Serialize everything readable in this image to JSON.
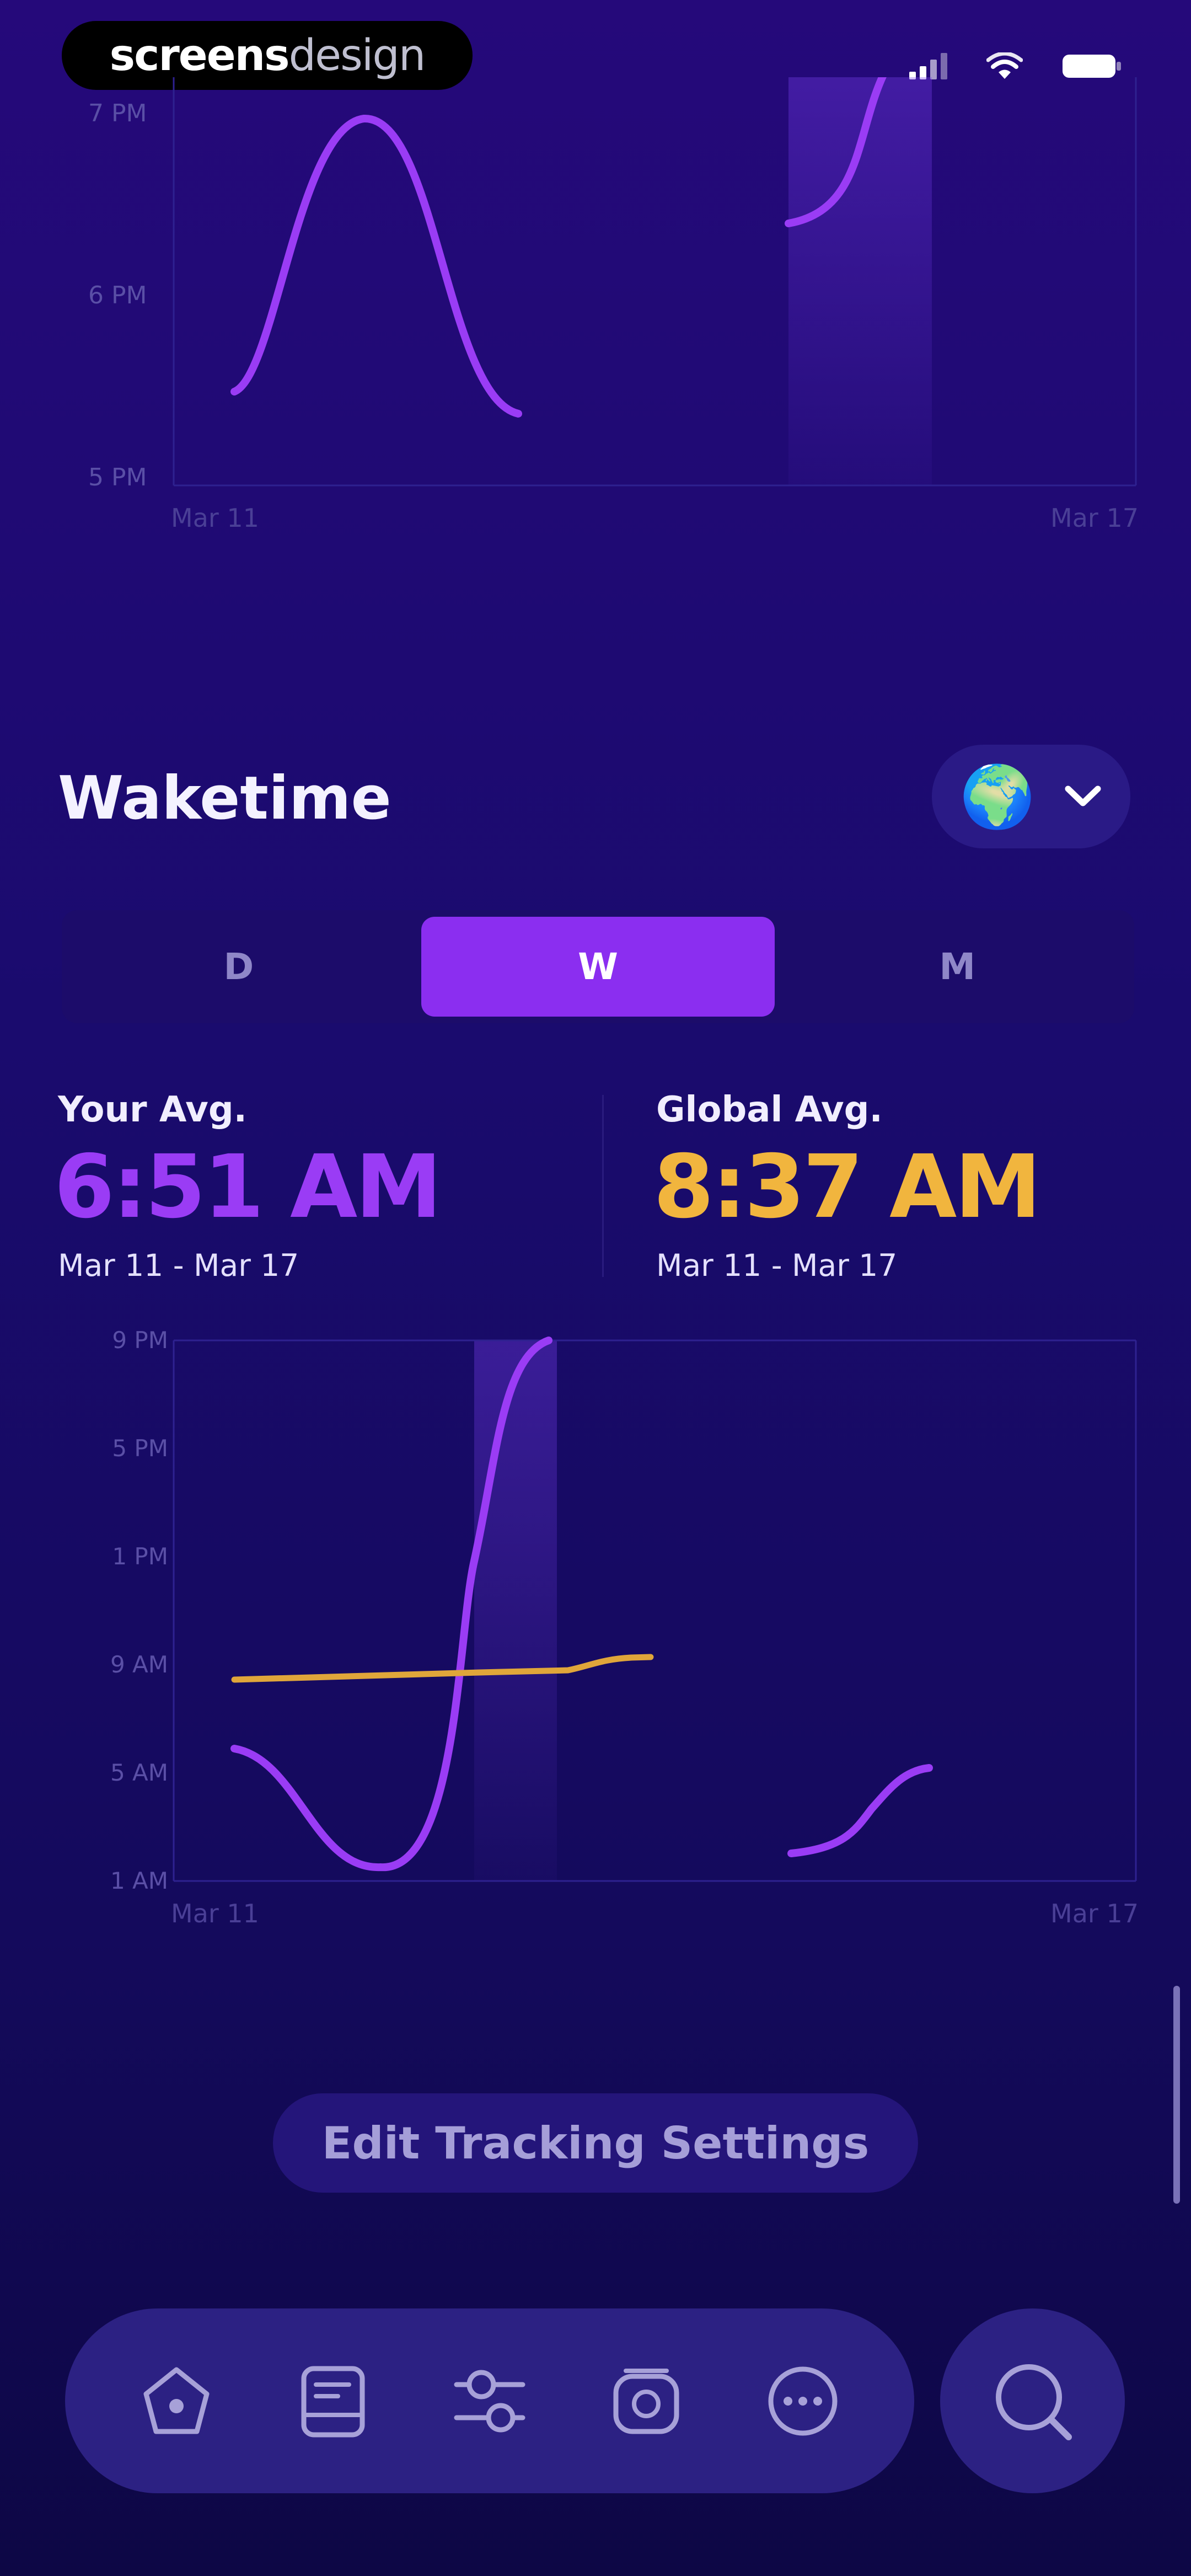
{
  "watermark": {
    "bold": "screens",
    "light": "design"
  },
  "top_chart": {
    "y_ticks": [
      "7 PM",
      "6 PM",
      "5 PM"
    ],
    "x_start": "Mar 11",
    "x_end": "Mar 17"
  },
  "section": {
    "title": "Waketime"
  },
  "region_selector": {
    "icon": "globe-icon",
    "chevron": "chevron-down-icon"
  },
  "segments": {
    "items": [
      {
        "label": "D",
        "active": false
      },
      {
        "label": "W",
        "active": true
      },
      {
        "label": "M",
        "active": false
      }
    ]
  },
  "your_avg": {
    "label": "Your Avg.",
    "value": "6:51 AM",
    "range": "Mar 11 - Mar 17",
    "color": "#9a3cf5"
  },
  "global_avg": {
    "label": "Global Avg.",
    "value": "8:37 AM",
    "range": "Mar 11 - Mar 17",
    "color": "#f1b53e"
  },
  "chart_data": {
    "type": "line",
    "y_ticks": [
      "9 PM",
      "5 PM",
      "1 PM",
      "9 AM",
      "5 AM",
      "1 AM"
    ],
    "x_start": "Mar 11",
    "x_end": "Mar 17",
    "series": [
      {
        "color": "#9a3cf5"
      },
      {
        "color": "#e0a63a"
      }
    ]
  },
  "edit_button": {
    "label": "Edit Tracking Settings"
  },
  "tab_bar": {
    "items": [
      {
        "icon": "home-icon"
      },
      {
        "icon": "journal-icon"
      },
      {
        "icon": "sliders-icon"
      },
      {
        "icon": "alarm-icon"
      },
      {
        "icon": "more-icon"
      }
    ]
  },
  "search_tab": {
    "icon": "search-icon"
  },
  "colors": {
    "accent": "#8b2ef0",
    "gold": "#f1b53e"
  }
}
